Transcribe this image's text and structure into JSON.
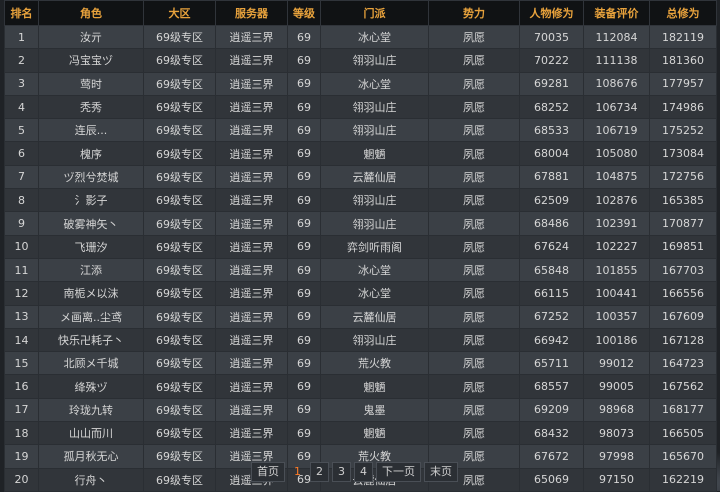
{
  "headers": [
    "排名",
    "角色",
    "大区",
    "服务器",
    "等级",
    "门派",
    "势力",
    "人物修为",
    "装备评价",
    "总修为"
  ],
  "rows": [
    [
      "1",
      "汝亓",
      "69级专区",
      "逍遥三界",
      "69",
      "冰心堂",
      "夙愿",
      "70035",
      "112084",
      "182119"
    ],
    [
      "2",
      "冯宝宝ヅ",
      "69级专区",
      "逍遥三界",
      "69",
      "翎羽山庄",
      "夙愿",
      "70222",
      "111138",
      "181360"
    ],
    [
      "3",
      "莺时",
      "69级专区",
      "逍遥三界",
      "69",
      "冰心堂",
      "夙愿",
      "69281",
      "108676",
      "177957"
    ],
    [
      "4",
      "秃秀",
      "69级专区",
      "逍遥三界",
      "69",
      "翎羽山庄",
      "夙愿",
      "68252",
      "106734",
      "174986"
    ],
    [
      "5",
      "连辰...",
      "69级专区",
      "逍遥三界",
      "69",
      "翎羽山庄",
      "夙愿",
      "68533",
      "106719",
      "175252"
    ],
    [
      "6",
      "槐序",
      "69级专区",
      "逍遥三界",
      "69",
      "魍魉",
      "夙愿",
      "68004",
      "105080",
      "173084"
    ],
    [
      "7",
      "ヅ烈兮焚城",
      "69级专区",
      "逍遥三界",
      "69",
      "云麓仙居",
      "夙愿",
      "67881",
      "104875",
      "172756"
    ],
    [
      "8",
      "氵影子",
      "69级专区",
      "逍遥三界",
      "69",
      "翎羽山庄",
      "夙愿",
      "62509",
      "102876",
      "165385"
    ],
    [
      "9",
      "破雾神矢丶",
      "69级专区",
      "逍遥三界",
      "69",
      "翎羽山庄",
      "夙愿",
      "68486",
      "102391",
      "170877"
    ],
    [
      "10",
      "飞珊汐",
      "69级专区",
      "逍遥三界",
      "69",
      "弈剑听雨阁",
      "夙愿",
      "67624",
      "102227",
      "169851"
    ],
    [
      "11",
      "江添",
      "69级专区",
      "逍遥三界",
      "69",
      "冰心堂",
      "夙愿",
      "65848",
      "101855",
      "167703"
    ],
    [
      "12",
      "南栀メ以沫",
      "69级专区",
      "逍遥三界",
      "69",
      "冰心堂",
      "夙愿",
      "66115",
      "100441",
      "166556"
    ],
    [
      "13",
      "メ画离..尘鸢",
      "69级专区",
      "逍遥三界",
      "69",
      "云麓仙居",
      "夙愿",
      "67252",
      "100357",
      "167609"
    ],
    [
      "14",
      "快乐卍耗子丶",
      "69级专区",
      "逍遥三界",
      "69",
      "翎羽山庄",
      "夙愿",
      "66942",
      "100186",
      "167128"
    ],
    [
      "15",
      "北顾メ千城",
      "69级专区",
      "逍遥三界",
      "69",
      "荒火教",
      "夙愿",
      "65711",
      "99012",
      "164723"
    ],
    [
      "16",
      "绛殊ヅ",
      "69级专区",
      "逍遥三界",
      "69",
      "魍魉",
      "夙愿",
      "68557",
      "99005",
      "167562"
    ],
    [
      "17",
      "玲珑九转",
      "69级专区",
      "逍遥三界",
      "69",
      "鬼墨",
      "夙愿",
      "69209",
      "98968",
      "168177"
    ],
    [
      "18",
      "山山而川",
      "69级专区",
      "逍遥三界",
      "69",
      "魍魉",
      "夙愿",
      "68432",
      "98073",
      "166505"
    ],
    [
      "19",
      "孤月秋无心",
      "69级专区",
      "逍遥三界",
      "69",
      "荒火教",
      "夙愿",
      "67672",
      "97998",
      "165670"
    ],
    [
      "20",
      "行舟丶",
      "69级专区",
      "逍遥三界",
      "69",
      "云麓仙居",
      "夙愿",
      "65069",
      "97150",
      "162219"
    ]
  ],
  "pager": {
    "first": "首页",
    "pages": [
      "1",
      "2",
      "3",
      "4"
    ],
    "current": "1",
    "next": "下一页",
    "last": "末页"
  }
}
